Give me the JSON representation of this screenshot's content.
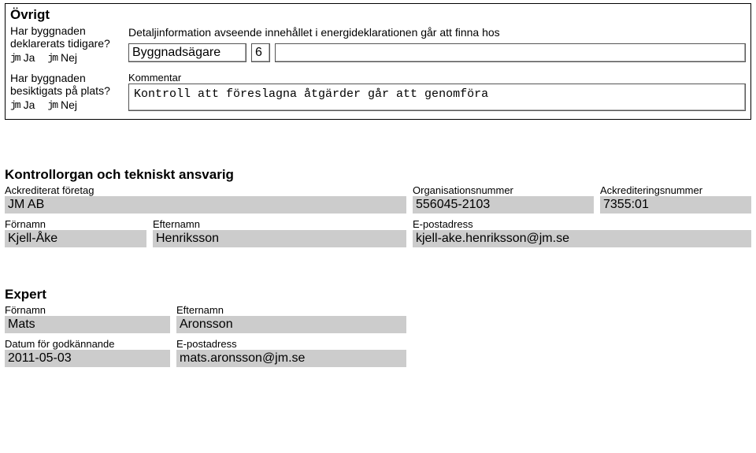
{
  "ovrigt": {
    "title": "Övrigt",
    "q1": "Har byggnaden deklarerats tidigare?",
    "q2": "Har byggnaden besiktigats på plats?",
    "ja": "Ja",
    "nej": "Nej",
    "detail_info": "Detaljinformation avseende innehållet i energideklarationen går att finna hos",
    "owner": "Byggnadsägare",
    "owner_num": "6",
    "komment_label": "Kommentar",
    "komment_text": "Kontroll att föreslagna åtgärder går att genomföra"
  },
  "kontroll": {
    "title": "Kontrollorgan och tekniskt ansvarig",
    "labels": {
      "ack_foretag": "Ackrediterat företag",
      "orgnr": "Organisationsnummer",
      "acknr": "Ackrediteringsnummer",
      "fornamn": "Förnamn",
      "efternamn": "Efternamn",
      "epost": "E-postadress"
    },
    "ack_foretag": "JM AB",
    "orgnr": "556045-2103",
    "acknr": "7355:01",
    "fornamn": "Kjell-Åke",
    "efternamn": "Henriksson",
    "epost": "kjell-ake.henriksson@jm.se"
  },
  "expert": {
    "title": "Expert",
    "labels": {
      "fornamn": "Förnamn",
      "efternamn": "Efternamn",
      "datum": "Datum för godkännande",
      "epost": "E-postadress"
    },
    "fornamn": "Mats",
    "efternamn": "Aronsson",
    "datum": "2011-05-03",
    "epost": "mats.aronsson@jm.se"
  }
}
